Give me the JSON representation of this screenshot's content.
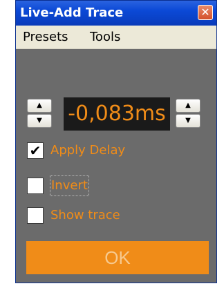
{
  "window": {
    "title": "Live-Add Trace",
    "close_glyph": "✕"
  },
  "menu": {
    "presets": "Presets",
    "tools": "Tools"
  },
  "delay": {
    "value": "-0,083ms",
    "up_glyph": "▲",
    "down_glyph": "▼"
  },
  "options": {
    "apply_delay": {
      "label": "Apply Delay",
      "checked": true
    },
    "invert": {
      "label": "Invert",
      "checked": false
    },
    "show_trace": {
      "label": "Show trace",
      "checked": false
    }
  },
  "ok_label": "OK",
  "colors": {
    "accent": "#f08c18",
    "panel": "#6b6b6b",
    "titlebar": "#0b49d6"
  },
  "icons": {
    "check_mark": "✔"
  }
}
